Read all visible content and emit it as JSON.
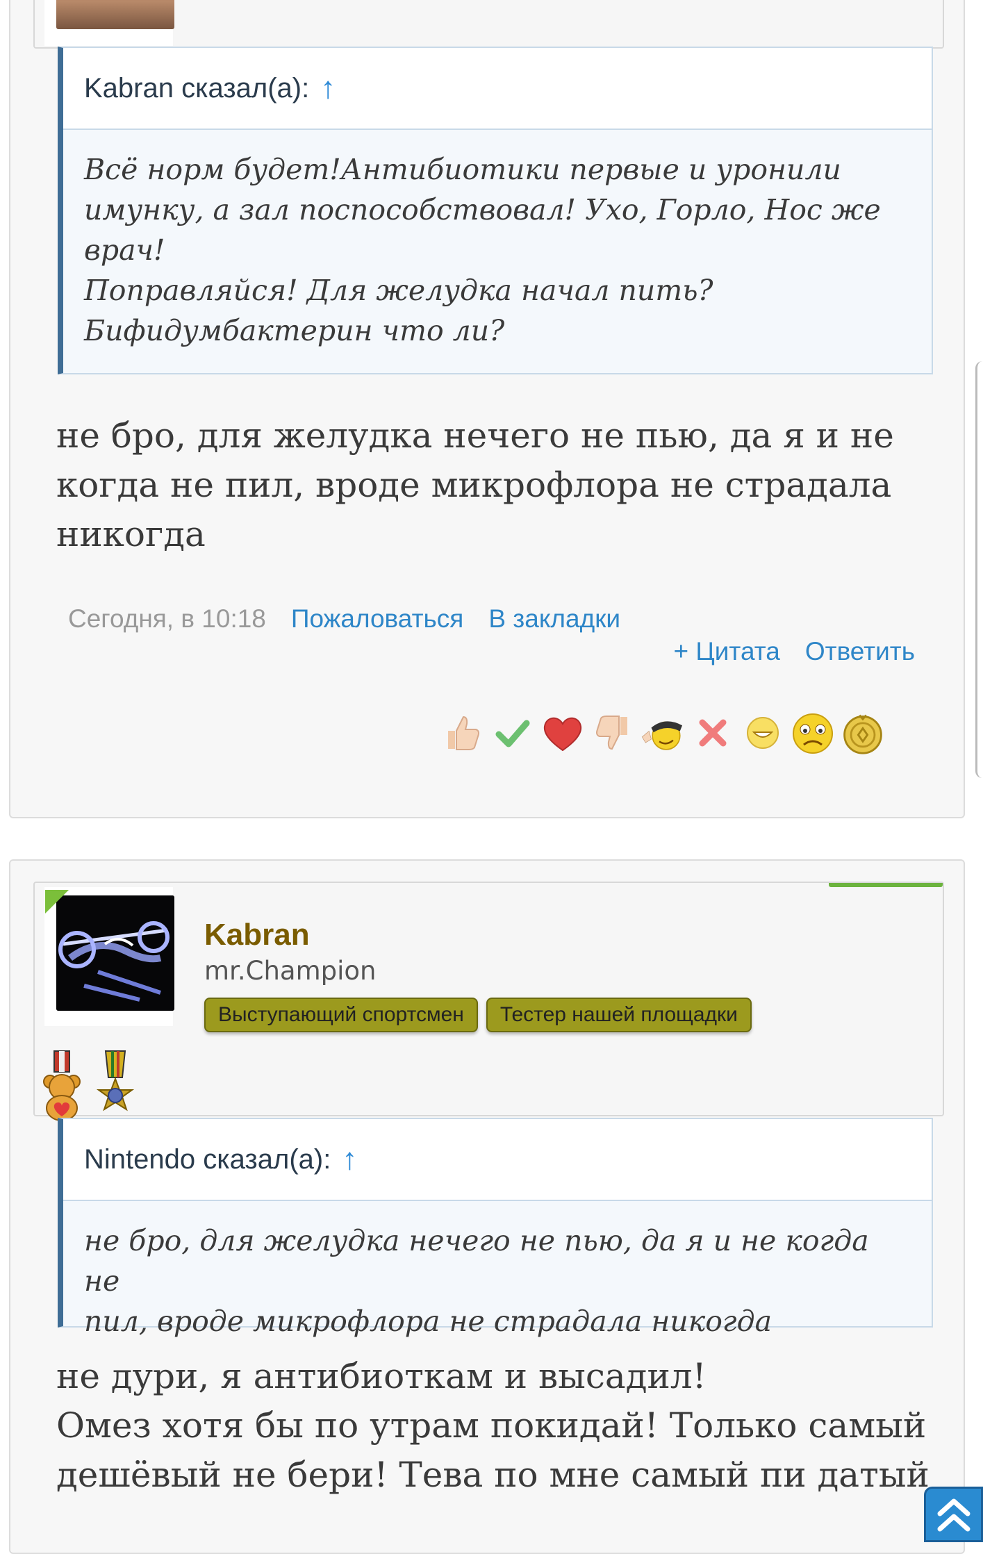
{
  "post1": {
    "quote": {
      "author_label": "Kabran сказал(а):",
      "arrow": "↑",
      "lines": [
        "Всё норм будет!Антибиотики первые и уронили",
        "имунку, а зал поспособствовал! Ухо, Горло, Нос же",
        "врач!",
        "Поправляйся! Для желудка начал пить?",
        "Бифидумбактерин что ли?"
      ]
    },
    "message_lines": [
      "не бро, для желудка нечего не пью, да я и не",
      "когда не пил, вроде микрофлора не страдала",
      "никогда"
    ],
    "timestamp": "Сегодня, в 10:18",
    "report_link": "Пожаловаться",
    "bookmark_link": "В закладки",
    "quote_link": "+ Цитата",
    "reply_link": "Ответить",
    "reactions": [
      "thumbs-up",
      "checkmark",
      "heart",
      "thumbs-down",
      "cool-smiley",
      "cross",
      "grin-smiley",
      "sad-smiley",
      "medal-coin"
    ]
  },
  "post2": {
    "username": "Kabran",
    "user_title": "mr.Champion",
    "badges": [
      "Выступающий спортсмен",
      "Тестер нашей площадки"
    ],
    "quote": {
      "author_label": "Nintendo сказал(а):",
      "arrow": "↑",
      "lines": [
        "не бро, для желудка нечего не пью, да я и не когда не",
        "пил, вроде микрофлора не страдала никогда"
      ]
    },
    "message_lines": [
      "не дури, я антибиоткам и высадил!",
      "Омез хотя бы по утрам покидай! Только самый",
      "дешёвый не бери! Тева по мне самый пи датый"
    ]
  },
  "colors": {
    "link": "#2e86c8",
    "username": "#7a5c00",
    "badge": "#9c9a1e",
    "quote_border": "#3f6d95",
    "online": "#7bbf3a"
  }
}
